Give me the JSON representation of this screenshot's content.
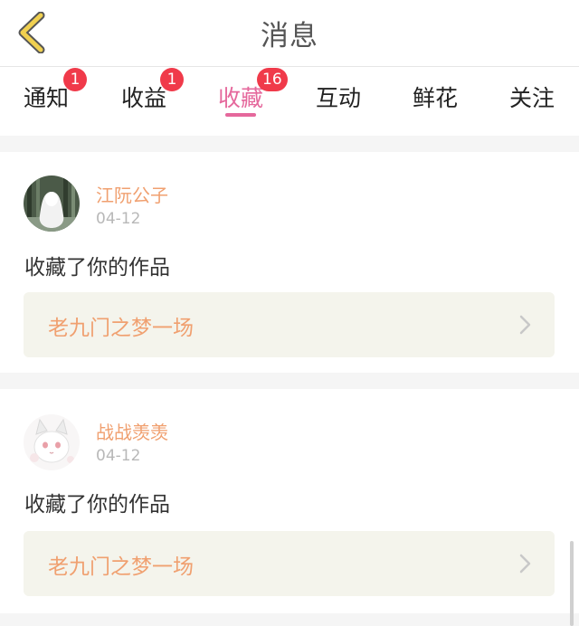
{
  "header": {
    "title": "消息",
    "back_icon": "chevron-left-icon",
    "back_color": "#f0d050"
  },
  "tabs": [
    {
      "label": "通知",
      "badge": "1"
    },
    {
      "label": "收益",
      "badge": "1"
    },
    {
      "label": "收藏",
      "badge": "16",
      "active": true
    },
    {
      "label": "互动"
    },
    {
      "label": "鲜花"
    },
    {
      "label": "关注"
    }
  ],
  "colors": {
    "active_tab": "#e5689c",
    "badge": "#f03a4a",
    "accent_text": "#f0a070",
    "card_link_bg": "#f4f4ec"
  },
  "items": [
    {
      "username": "江阮公子",
      "date": "04-12",
      "action": "收藏了你的作品",
      "work_title": "老九门之梦一场",
      "avatar": "forest-ghost-avatar"
    },
    {
      "username": "战战羡羡",
      "date": "04-12",
      "action": "收藏了你的作品",
      "work_title": "老九门之梦一场",
      "avatar": "white-cat-avatar"
    }
  ]
}
